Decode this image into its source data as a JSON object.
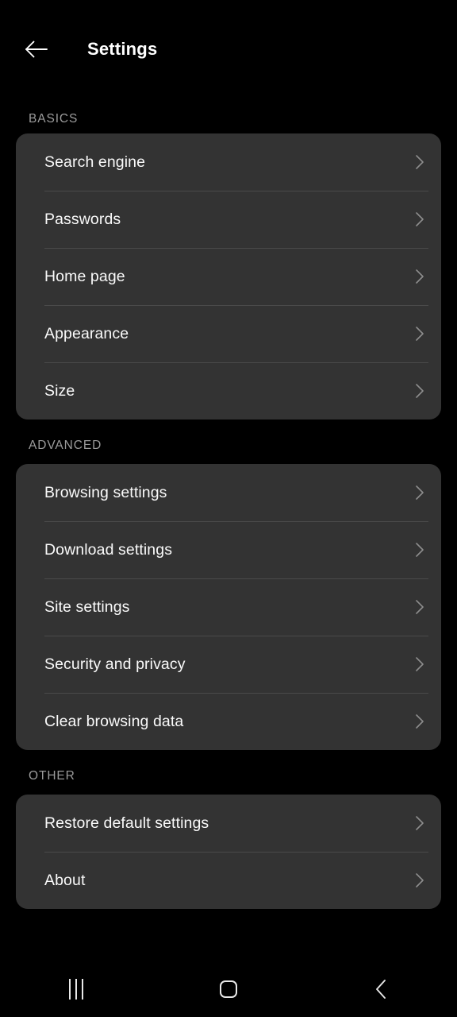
{
  "header": {
    "back_icon": "arrow-left-icon",
    "title": "Settings"
  },
  "sections": [
    {
      "label": "BASICS",
      "items": [
        {
          "label": "Search engine",
          "chevron": "chevron-right-icon"
        },
        {
          "label": "Passwords",
          "chevron": "chevron-right-icon"
        },
        {
          "label": "Home page",
          "chevron": "chevron-right-icon"
        },
        {
          "label": "Appearance",
          "chevron": "chevron-right-icon"
        },
        {
          "label": "Size",
          "chevron": "chevron-right-icon"
        }
      ]
    },
    {
      "label": "ADVANCED",
      "items": [
        {
          "label": "Browsing settings",
          "chevron": "chevron-right-icon"
        },
        {
          "label": "Download settings",
          "chevron": "chevron-right-icon"
        },
        {
          "label": "Site settings",
          "chevron": "chevron-right-icon"
        },
        {
          "label": "Security and privacy",
          "chevron": "chevron-right-icon"
        },
        {
          "label": "Clear browsing data",
          "chevron": "chevron-right-icon"
        }
      ]
    },
    {
      "label": "OTHER",
      "items": [
        {
          "label": "Restore default settings",
          "chevron": "chevron-right-icon"
        },
        {
          "label": "About",
          "chevron": "chevron-right-icon"
        }
      ]
    }
  ],
  "navbar": {
    "recents": "recents-icon",
    "home": "home-icon",
    "back": "back-chevron-icon"
  },
  "colors": {
    "background": "#000000",
    "card": "#333333",
    "divider": "#4a4a4a",
    "primary_text": "#fafafa",
    "secondary_text": "#9b9b9b",
    "chevron": "#8d8d8d"
  }
}
